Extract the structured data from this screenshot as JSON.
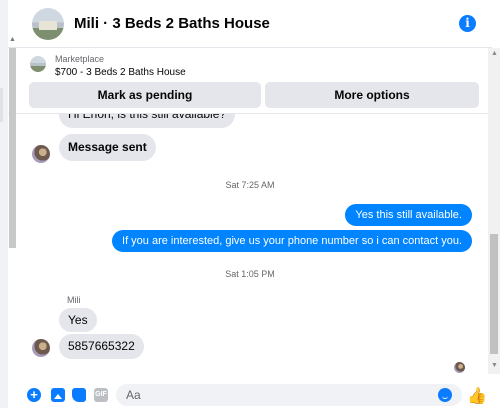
{
  "header": {
    "title": "Mili · 3 Beds 2 Baths House",
    "avatar_icon": "house-avatar",
    "info_icon": "info-icon",
    "info_glyph": "i"
  },
  "marketplace": {
    "label": "Marketplace",
    "listing": "$700 - 3 Beds 2 Baths House",
    "buttons": {
      "mark_pending": "Mark as pending",
      "more_options": "More options"
    }
  },
  "messages": [
    {
      "type": "incoming",
      "text": "Hi Erion, is this still available?"
    },
    {
      "type": "incoming",
      "text": "Message sent"
    },
    {
      "type": "timestamp",
      "text": "Sat 7:25 AM"
    },
    {
      "type": "outgoing",
      "text": "Yes this still available."
    },
    {
      "type": "outgoing",
      "text": "If you are interested, give us your phone number so i can contact you."
    },
    {
      "type": "timestamp",
      "text": "Sat 1:05 PM"
    },
    {
      "type": "sender",
      "text": "Mili"
    },
    {
      "type": "incoming",
      "text": "Yes"
    },
    {
      "type": "incoming",
      "text": "5857665322"
    }
  ],
  "composer": {
    "placeholder": "Aa",
    "gif_label": "GIF",
    "plus_glyph": "+",
    "like_glyph": "👍"
  },
  "colors": {
    "accent": "#0a7cff",
    "outgoing_bubble": "#0084ff",
    "incoming_bubble": "#e4e6eb"
  }
}
